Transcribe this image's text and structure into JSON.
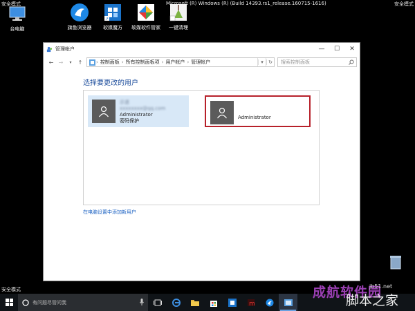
{
  "screen": {
    "safe_mode_top_left": "安全模式",
    "build_text": "Microsoft (R) Windows (R) (Build 14393.rs1_release.160715-1616)",
    "safe_mode_top_right": "安全模式",
    "safe_mode_bottom_left": "安全模式"
  },
  "desktop_icons": [
    {
      "label": "台电脑",
      "icon": "computer-icon"
    },
    {
      "label": "旗鱼浏览器",
      "icon": "browser-icon"
    },
    {
      "label": "软媒魔方",
      "icon": "cube-icon"
    },
    {
      "label": "软媒软件管家",
      "icon": "manager-icon"
    },
    {
      "label": "一键清理",
      "icon": "broom-icon"
    }
  ],
  "window": {
    "title": "管理帐户",
    "breadcrumbs": [
      "控制面板",
      "所有控制面板项",
      "用户帐户",
      "管理帐户"
    ],
    "search_placeholder": "搜索控制面板",
    "heading": "选择要更改的用户",
    "accounts": [
      {
        "name": "示道",
        "email": "xxxxxxxx@qq.com",
        "role": "Administrator",
        "protection": "密码保护",
        "selected": false
      },
      {
        "role": "Administrator",
        "selected": true
      }
    ],
    "add_user_link": "在电脑设置中添加新用户"
  },
  "taskbar": {
    "search_placeholder": "有问题尽管问我"
  },
  "watermark": {
    "left": "成航软件园",
    "right": "脚本之家",
    "site": "jb51.net"
  },
  "colors": {
    "accent": "#1e4e9c",
    "selection_border": "#b7202a",
    "selected_bg": "#d8e8f7"
  }
}
